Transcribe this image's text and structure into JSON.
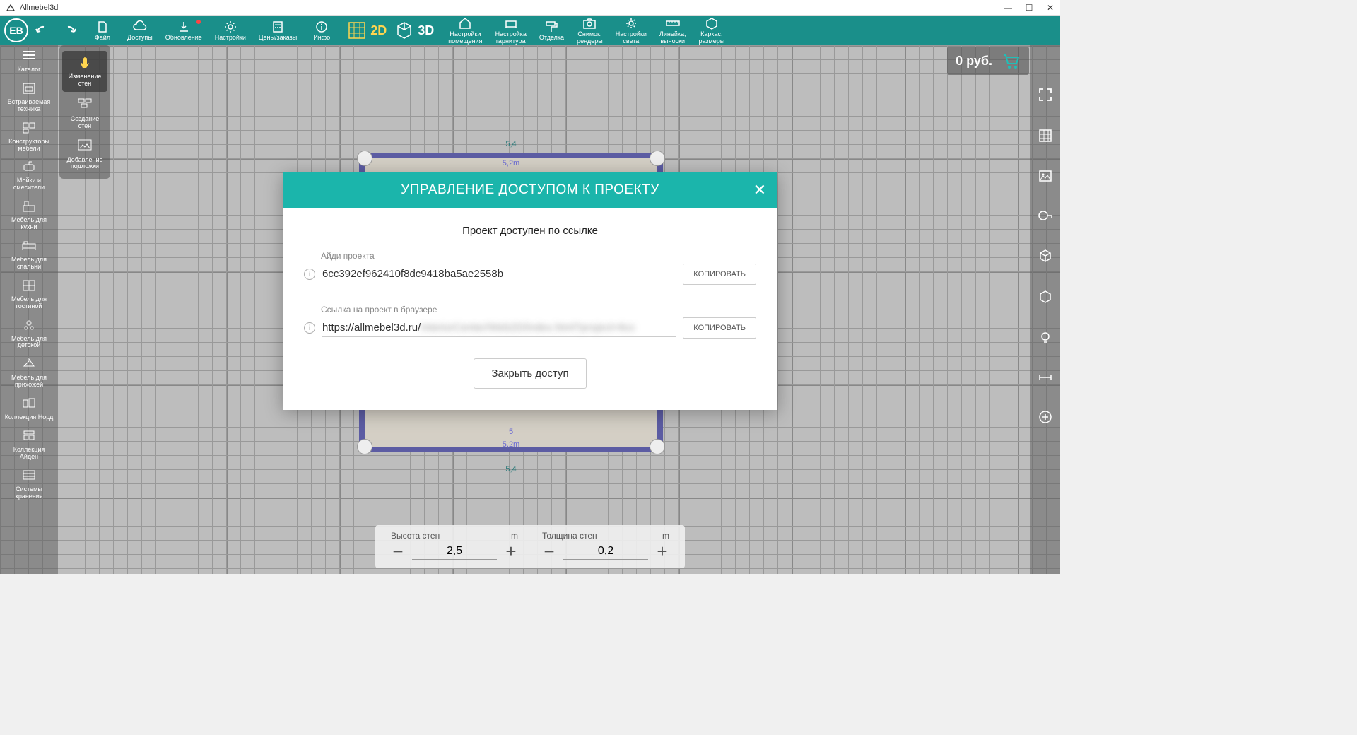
{
  "app_title": "Allmebel3d",
  "eb_badge": "ЕВ",
  "toolbar": {
    "file": "Файл",
    "access": "Доступы",
    "update": "Обновление",
    "settings": "Настройки",
    "prices": "Цены/заказы",
    "info": "Инфо",
    "view2d": "2D",
    "view3d": "3D",
    "room_settings": "Настройки\nпомещения",
    "furniture_settings": "Настройка\nгарнитура",
    "finishing": "Отделка",
    "snapshot": "Снимок,\nрендеры",
    "light_settings": "Настройки\nсвета",
    "ruler": "Линейка,\nвыноски",
    "frame": "Каркас,\nразмеры"
  },
  "left_sidebar": [
    "Каталог",
    "Встраиваемая\nтехника",
    "Конструкторы\nмебели",
    "Мойки и\nсмесители",
    "Мебель для\nкухни",
    "Мебель для\nспальни",
    "Мебель для\nгостиной",
    "Мебель для\nдетской",
    "Мебель для\nприхожей",
    "Коллекция Норд",
    "Коллекция\nАйден",
    "Системы\nхранения"
  ],
  "left_sidebar2": [
    "Изменение\nстен",
    "Создание\nстен",
    "Добавление\nподложки"
  ],
  "price": "0 руб.",
  "dimensions": {
    "top_outer": "5,4",
    "top_inner": "5,2m",
    "bottom_outer": "5,4",
    "bottom_inner": "5,2m",
    "floor": "5"
  },
  "bottom": {
    "wall_height_label": "Высота стен",
    "wall_height_unit": "m",
    "wall_height_value": "2,5",
    "wall_thickness_label": "Толщина стен",
    "wall_thickness_unit": "m",
    "wall_thickness_value": "0,2"
  },
  "modal": {
    "title": "УПРАВЛЕНИЕ ДОСТУПОМ К ПРОЕКТУ",
    "subtitle": "Проект доступен по ссылке",
    "id_label": "Айди проекта",
    "id_value": "6cc392ef962410f8dc9418ba5ae2558b",
    "link_label": "Ссылка на проект в браузере",
    "link_prefix": "https://allmebel3d.ru/",
    "copy": "КОПИРОВАТЬ",
    "close_access": "Закрыть доступ"
  }
}
